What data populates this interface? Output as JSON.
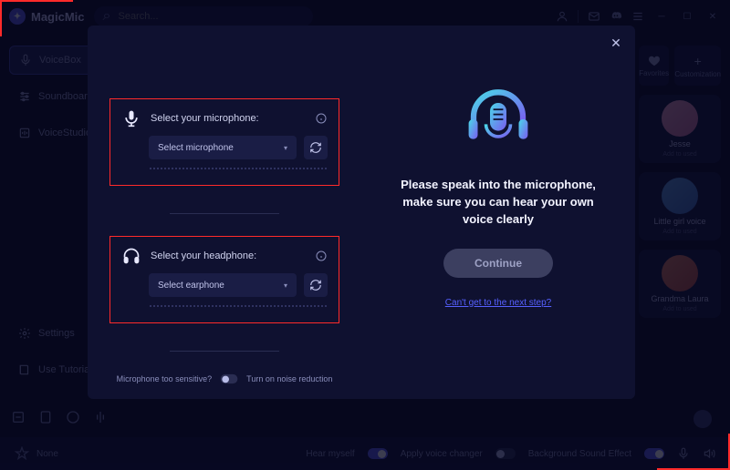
{
  "app": {
    "name": "MagicMic"
  },
  "search": {
    "placeholder": "Search..."
  },
  "sidebar": {
    "items": [
      {
        "label": "VoiceBox"
      },
      {
        "label": "Soundboard"
      },
      {
        "label": "VoiceStudio"
      },
      {
        "label": "Settings"
      },
      {
        "label": "Use Tutorial"
      }
    ]
  },
  "right_tiles": {
    "fav": "Favorites",
    "cust": "Customization"
  },
  "cards": [
    {
      "name": "Jesse",
      "sub": "Add to used"
    },
    {
      "name": "Little girl voice",
      "sub": "Add to used"
    },
    {
      "name": "Grandma Laura",
      "sub": "Add to used"
    }
  ],
  "bottombar": {
    "none": "None",
    "hear": "Hear myself",
    "apply": "Apply voice changer",
    "bg": "Background Sound Effect"
  },
  "modal": {
    "mic_label": "Select your microphone:",
    "mic_select": "Select microphone",
    "hp_label": "Select your headphone:",
    "hp_select": "Select earphone",
    "noise_q": "Microphone too sensitive?",
    "noise_t": "Turn on noise reduction",
    "instr": "Please speak into the microphone, make sure you can hear your own voice clearly",
    "continue": "Continue",
    "link": "Can't get to the next step?"
  }
}
